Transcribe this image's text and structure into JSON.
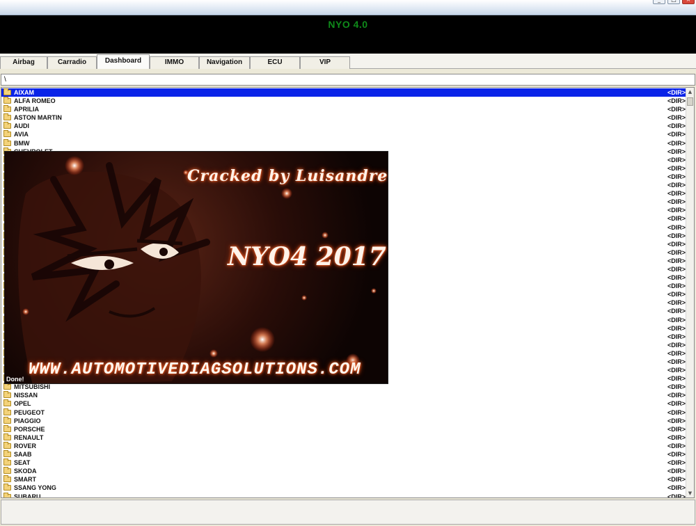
{
  "window": {
    "controls": [
      "_",
      "□",
      "×"
    ]
  },
  "header": {
    "title": "NYO 4.0"
  },
  "tabs": [
    {
      "label": "Airbag"
    },
    {
      "label": "Carradio"
    },
    {
      "label": "Dashboard"
    },
    {
      "label": "IMMO"
    },
    {
      "label": "Navigation"
    },
    {
      "label": "ECU"
    },
    {
      "label": "VIP"
    }
  ],
  "path": {
    "value": "\\"
  },
  "dir_label": "<DIR>",
  "list": [
    {
      "name": "AIXAM",
      "type": "<DIR>"
    },
    {
      "name": "ALFA ROMEO",
      "type": "<DIR>"
    },
    {
      "name": "APRILIA",
      "type": "<DIR>"
    },
    {
      "name": "ASTON MARTIN",
      "type": "<DIR>"
    },
    {
      "name": "AUDI",
      "type": "<DIR>"
    },
    {
      "name": "AVIA",
      "type": "<DIR>"
    },
    {
      "name": "BMW",
      "type": "<DIR>"
    },
    {
      "name": "CHEVROLET",
      "type": "<DIR>"
    }
  ],
  "list_tail": [
    {
      "name": "MITSUBISHI",
      "type": "<DIR>"
    },
    {
      "name": "NISSAN",
      "type": "<DIR>"
    },
    {
      "name": "OPEL",
      "type": "<DIR>"
    },
    {
      "name": "PEUGEOT",
      "type": "<DIR>"
    },
    {
      "name": "PIAGGIO",
      "type": "<DIR>"
    },
    {
      "name": "PORSCHE",
      "type": "<DIR>"
    },
    {
      "name": "RENAULT",
      "type": "<DIR>"
    },
    {
      "name": "ROVER",
      "type": "<DIR>"
    },
    {
      "name": "SAAB",
      "type": "<DIR>"
    },
    {
      "name": "SEAT",
      "type": "<DIR>"
    },
    {
      "name": "SKODA",
      "type": "<DIR>"
    },
    {
      "name": "SMART",
      "type": "<DIR>"
    },
    {
      "name": "SSANG YONG",
      "type": "<DIR>"
    },
    {
      "name": "SUBARU",
      "type": "<DIR>"
    }
  ],
  "hidden_row_count": 27,
  "selected_item": "AIXAM",
  "splash": {
    "cracked_text": "Cracked by Luisandre",
    "version_text": "NYO4 2017",
    "site_text": "WWW.AUTOMOTIVEDIAGSOLUTIONS.COM",
    "status": "Done!"
  }
}
